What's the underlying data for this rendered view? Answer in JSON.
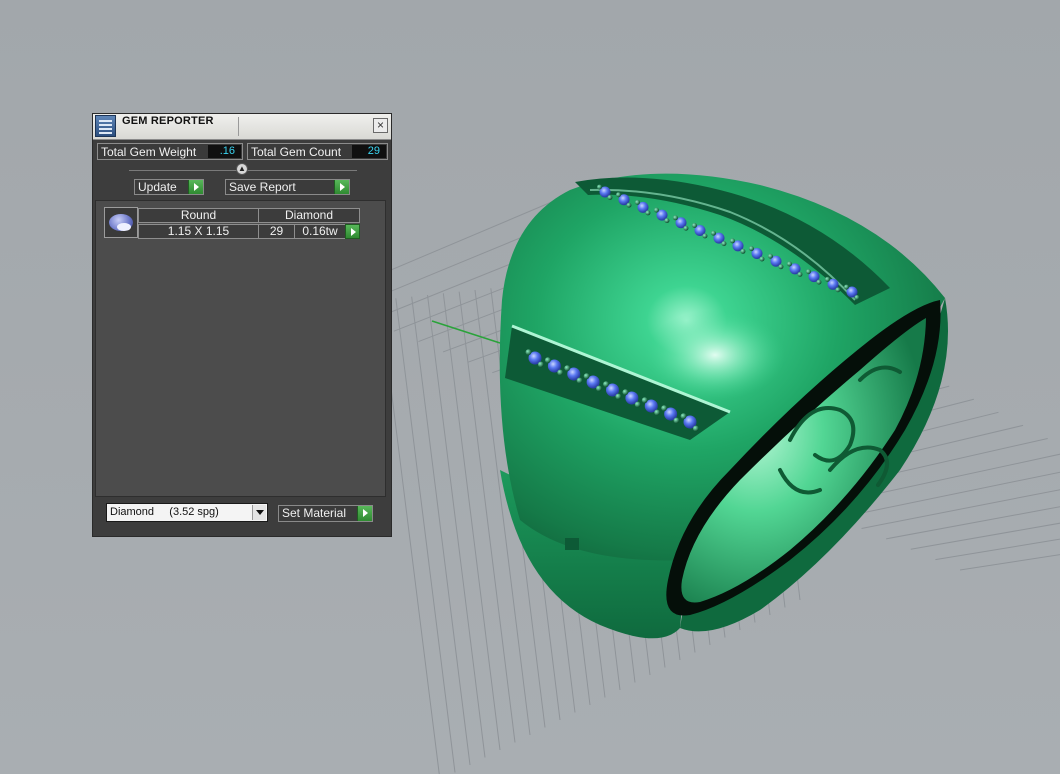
{
  "panel": {
    "title": "GEM REPORTER",
    "close_label": "×",
    "total_weight_label": "Total Gem Weight",
    "total_weight_value": ".16",
    "total_count_label": "Total Gem Count",
    "total_count_value": "29",
    "update_label": "Update",
    "save_report_label": "Save Report",
    "gem_rows": [
      {
        "shape": "Round",
        "material": "Diamond",
        "size": "1.15 X 1.15",
        "count": "29",
        "weight": "0.16tw"
      }
    ],
    "material_select_value": "Diamond     (3.52 spg)",
    "set_material_label": "Set Material"
  },
  "colors": {
    "viewport_bg": "#a5aaae",
    "ring_green": "#1f9a5c",
    "gem_blue": "#4f6ff0",
    "value_text": "#3ad3f0",
    "go_button": "#3a9a3c"
  }
}
